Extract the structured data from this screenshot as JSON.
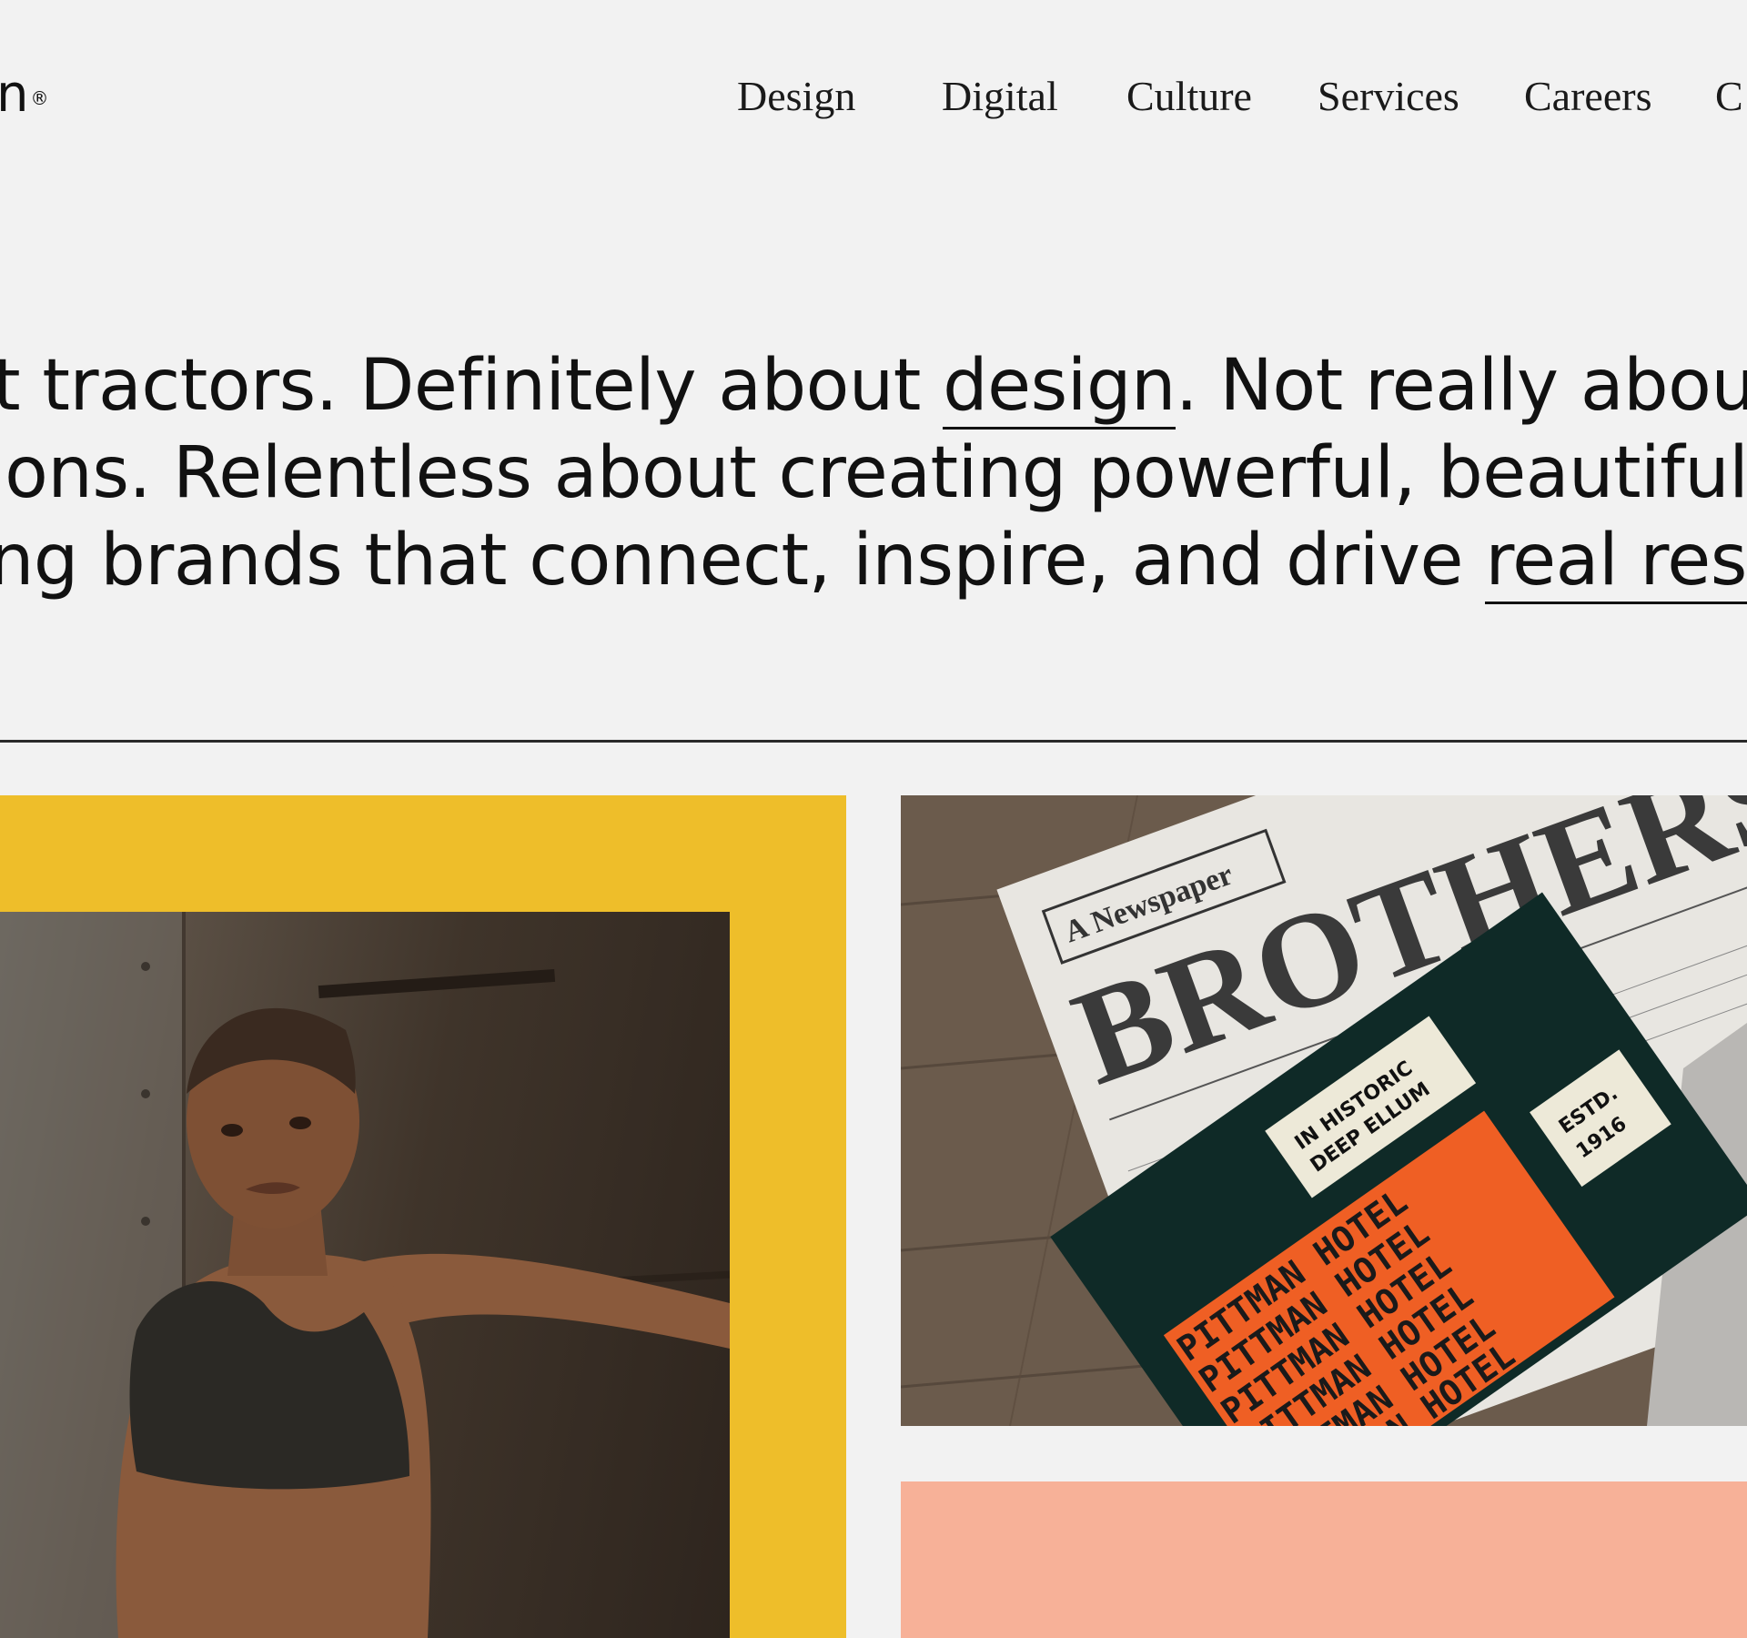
{
  "header": {
    "logo_text": "n",
    "logo_mark": "®",
    "nav": [
      "Design",
      "Digital",
      "Culture",
      "Services",
      "Careers",
      "C"
    ]
  },
  "hero": {
    "line1_before": "t tractors. Definitely about ",
    "line1_link": "design",
    "line1_after": ". Not really about",
    "line2": "ions. Relentless about creating powerful, beautiful,",
    "line3_before": "ng brands that connect, inspire, and drive ",
    "line3_link": "real results"
  },
  "cards": {
    "hotel": {
      "newspaper_masthead": "A Newspaper",
      "newspaper_title": "BROTHERS",
      "tag1_line1": "IN HISTORIC",
      "tag1_line2": "DEEP ELLUM",
      "tag2_line1": "ESTD.",
      "tag2_line2": "1916",
      "pattern_text": "PITTMAN HOTEL"
    }
  },
  "colors": {
    "background": "#f2f2f2",
    "yellow": "#eebe2a",
    "peach": "#f7b198",
    "hotel_green": "#0f2a27",
    "hotel_orange": "#ef5f24"
  }
}
